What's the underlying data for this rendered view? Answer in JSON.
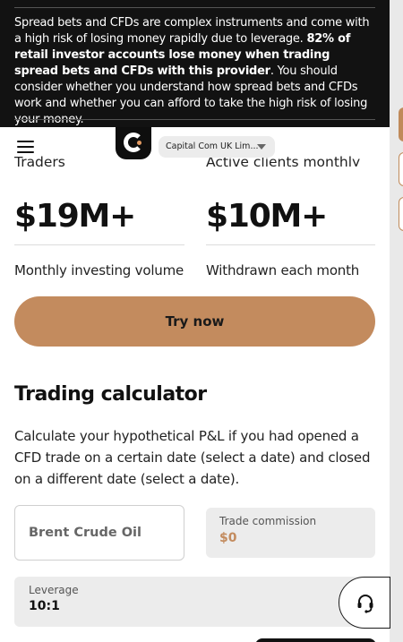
{
  "risk_warning": {
    "part1": "Spread bets and CFDs are complex instruments and come with a high risk of losing money rapidly due to leverage. ",
    "bold": "82% of retail investor accounts lose money when trading spread bets and CFDs with this provider",
    "part2": ". You should consider whether you understand how spread bets and CFDs work and whether you can afford to take the high risk of losing your money."
  },
  "header": {
    "menu_icon": "hamburger-menu-icon",
    "logo_icon": "capital-com-logo",
    "entity_selector": "Capital Com UK Lim..."
  },
  "stats": [
    {
      "label": "Traders",
      "value": "$19M+",
      "caption": "Monthly investing volume"
    },
    {
      "label": "Active clients monthly",
      "value": "$10M+",
      "caption": "Withdrawn each month"
    }
  ],
  "cta": {
    "label": "Try now"
  },
  "calculator": {
    "title": "Trading calculator",
    "description": "Calculate your hypothetical P&L if you had opened a CFD trade on a certain date (select a date) and closed on a different date (select a date).",
    "asset": "Brent Crude Oil",
    "commission_label": "Trade commission",
    "commission_value": "$0",
    "leverage_label": "Leverage",
    "leverage_value": "10:1"
  },
  "support": {
    "icon": "headset-icon"
  },
  "colors": {
    "accent": "#c38b5e",
    "banner_bg": "#121212",
    "field_bg": "#ececec"
  }
}
